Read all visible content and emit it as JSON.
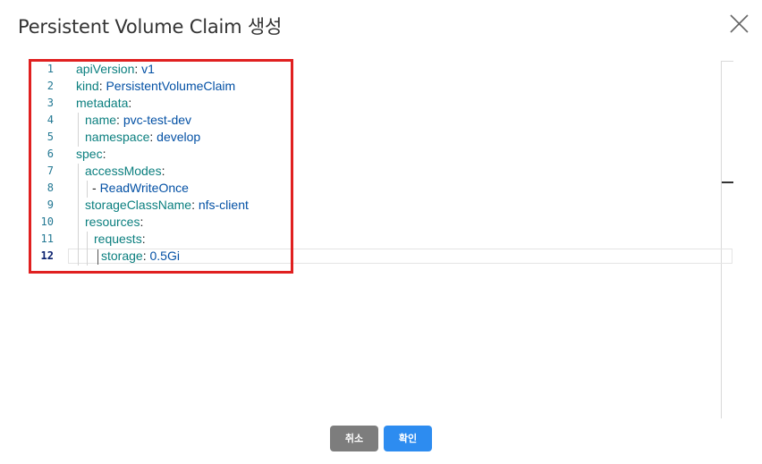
{
  "dialog": {
    "title": "Persistent Volume Claim 생성",
    "close_icon": "close-icon"
  },
  "editor": {
    "active_line": 12,
    "lines": [
      {
        "num": "1",
        "key": "apiVersion",
        "value": "v1"
      },
      {
        "num": "2",
        "key": "kind",
        "value": "PersistentVolumeClaim"
      },
      {
        "num": "3",
        "key": "metadata",
        "value": ""
      },
      {
        "num": "4",
        "key": "name",
        "value": "pvc-test-dev"
      },
      {
        "num": "5",
        "key": "namespace",
        "value": "develop"
      },
      {
        "num": "6",
        "key": "spec",
        "value": ""
      },
      {
        "num": "7",
        "key": "accessModes",
        "value": ""
      },
      {
        "num": "8",
        "key": "",
        "value": "ReadWriteOnce"
      },
      {
        "num": "9",
        "key": "storageClassName",
        "value": "nfs-client"
      },
      {
        "num": "10",
        "key": "resources",
        "value": ""
      },
      {
        "num": "11",
        "key": "requests",
        "value": ""
      },
      {
        "num": "12",
        "key": "storage",
        "value": "0.5Gi"
      }
    ]
  },
  "buttons": {
    "cancel_label": "취소",
    "confirm_label": "확인"
  },
  "colors": {
    "highlight": "#e02020",
    "key": "#0b7f7f",
    "value": "#0451a5",
    "line_number": "#237893",
    "confirm": "#2d8cf0",
    "cancel": "#7d7d7d"
  }
}
